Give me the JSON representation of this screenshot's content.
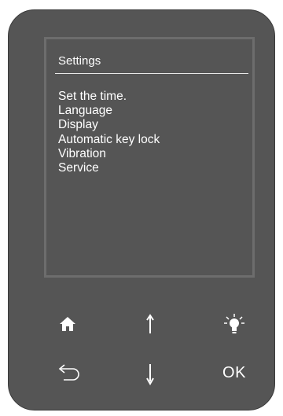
{
  "screen": {
    "title": "Settings",
    "menu_items": [
      "Set the time.",
      "Language",
      "Display",
      "Automatic key lock",
      "Vibration",
      "Service"
    ]
  },
  "keys": {
    "home": {
      "icon": "home-icon"
    },
    "up": {
      "icon": "arrow-up-icon"
    },
    "light": {
      "icon": "light-bulb-icon"
    },
    "back": {
      "icon": "back-arrow-icon"
    },
    "down": {
      "icon": "arrow-down-icon"
    },
    "ok": {
      "label": "OK"
    }
  },
  "colors": {
    "device_body": "#555555",
    "screen_border": "#6d6d6d",
    "text": "#ffffff"
  }
}
